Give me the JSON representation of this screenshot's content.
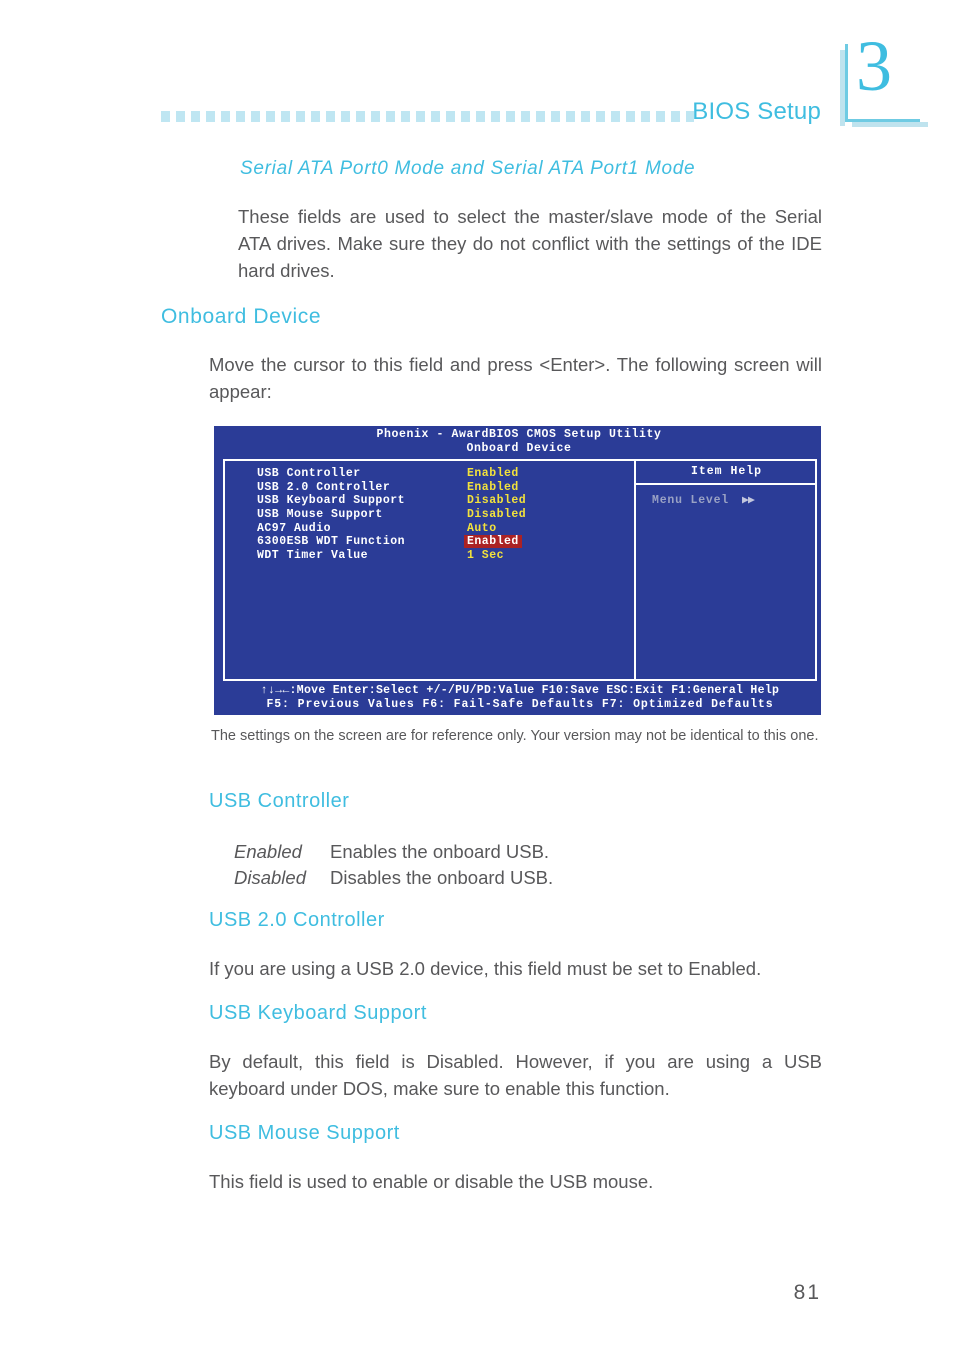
{
  "header": {
    "title": "BIOS Setup",
    "chapter_number": "3",
    "accent_color": "#3fbde0",
    "dot_color": "#bfe6f2"
  },
  "sections": {
    "serial_ata": {
      "heading": "Serial ATA Port0 Mode and Serial ATA Port1  Mode",
      "body": "These fields are used to select the master/slave mode of the Serial ATA drives. Make sure they do not conflict with the settings of the IDE hard drives."
    },
    "onboard_device": {
      "heading": "Onboard Device",
      "body": "Move the cursor to this field and press <Enter>. The following screen will appear:"
    },
    "usb_controller": {
      "heading": "USB Controller",
      "options": [
        {
          "term": "Enabled",
          "desc": "Enables the onboard USB."
        },
        {
          "term": "Disabled",
          "desc": "Disables the onboard USB."
        }
      ]
    },
    "usb20_controller": {
      "heading": "USB 2.0 Controller",
      "body": "If you are using a USB 2.0 device, this field must be set to Enabled."
    },
    "usb_keyboard_support": {
      "heading": "USB Keyboard Support",
      "body": "By default, this field is Disabled. However, if you are using a USB keyboard under DOS, make sure to enable this function."
    },
    "usb_mouse_support": {
      "heading": "USB Mouse Support",
      "body": "This field is used to enable or disable the USB mouse."
    }
  },
  "bios_screen": {
    "title_line1": "Phoenix - AwardBIOS CMOS Setup Utility",
    "title_line2": "Onboard Device",
    "bg_color": "#2b3c97",
    "value_color": "#f2e23c",
    "highlight_bg": "#ab2224",
    "rows": [
      {
        "label": "USB Controller",
        "value": "Enabled",
        "highlighted": false
      },
      {
        "label": "USB 2.0 Controller",
        "value": "Enabled",
        "highlighted": false
      },
      {
        "label": "USB Keyboard Support",
        "value": "Disabled",
        "highlighted": false
      },
      {
        "label": "USB Mouse Support",
        "value": "Disabled",
        "highlighted": false
      },
      {
        "label": "AC97 Audio",
        "value": "Auto",
        "highlighted": false
      },
      {
        "label": "6300ESB WDT Function",
        "value": "Enabled",
        "highlighted": true
      },
      {
        "label": "WDT Timer Value",
        "value": "1   Sec",
        "highlighted": false
      }
    ],
    "item_help": {
      "title": "Item Help",
      "menu_level_label": "Menu Level",
      "menu_level_arrows": "▶▶"
    },
    "footer_line1": "↑↓→←:Move   Enter:Select   +/-/PU/PD:Value   F10:Save   ESC:Exit   F1:General Help",
    "footer_line2": "F5: Previous Values     F6: Fail-Safe Defaults     F7: Optimized Defaults"
  },
  "caption": "The settings on the screen are for reference only. Your version may not be identical to this one.",
  "page_number": "81"
}
